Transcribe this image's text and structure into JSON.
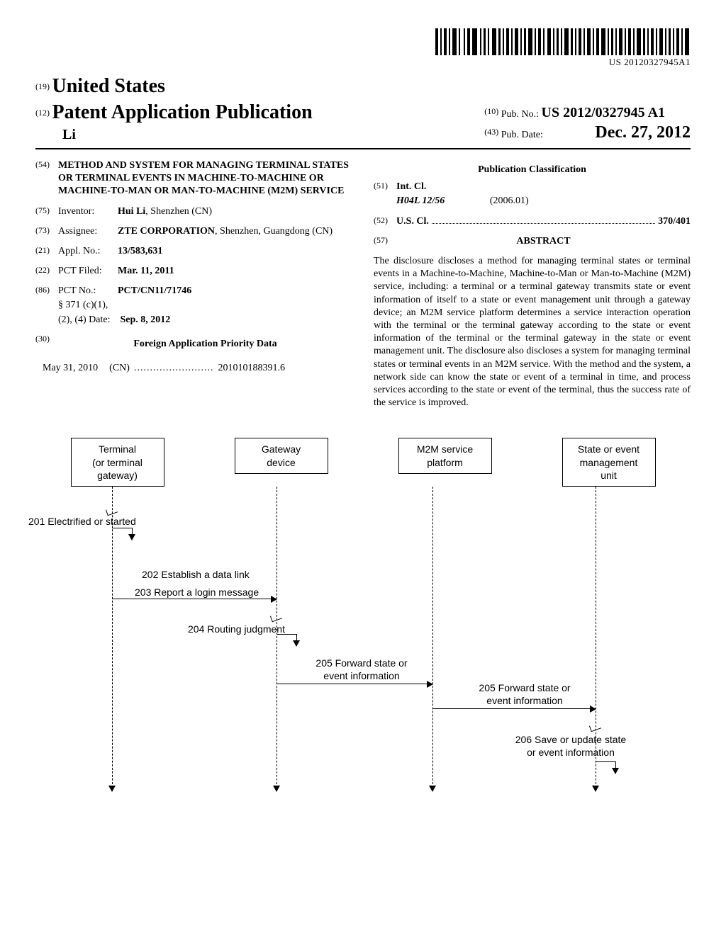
{
  "barcode_number": "US 20120327945A1",
  "header": {
    "code19": "(19)",
    "country": "United States",
    "code12": "(12)",
    "pap": "Patent Application Publication",
    "author": "Li",
    "code10": "(10)",
    "pubno_label": "Pub. No.:",
    "pubno_value": "US 2012/0327945 A1",
    "code43": "(43)",
    "pubdate_label": "Pub. Date:",
    "pubdate_value": "Dec. 27, 2012"
  },
  "left": {
    "c54": "(54)",
    "title": "METHOD AND SYSTEM FOR MANAGING TERMINAL STATES OR TERMINAL EVENTS IN MACHINE-TO-MACHINE OR MACHINE-TO-MAN OR MAN-TO-MACHINE (M2M) SERVICE",
    "c75": "(75)",
    "inventor_label": "Inventor:",
    "inventor": "Hui Li",
    "inventor_loc": ", Shenzhen (CN)",
    "c73": "(73)",
    "assignee_label": "Assignee:",
    "assignee": "ZTE CORPORATION",
    "assignee_loc": ", Shenzhen, Guangdong (CN)",
    "c21": "(21)",
    "appl_label": "Appl. No.:",
    "appl": "13/583,631",
    "c22": "(22)",
    "pct_filed_label": "PCT Filed:",
    "pct_filed": "Mar. 11, 2011",
    "c86": "(86)",
    "pct_no_label": "PCT No.:",
    "pct_no": "PCT/CN11/71746",
    "s371a": "§ 371 (c)(1),",
    "s371b": "(2), (4) Date:",
    "s371_date": "Sep. 8, 2012",
    "c30": "(30)",
    "foreign_header": "Foreign Application Priority Data",
    "foreign_date": "May 31, 2010",
    "foreign_cc": "(CN)",
    "foreign_dots": ".........................",
    "foreign_num": "201010188391.6"
  },
  "right": {
    "pubclass_header": "Publication Classification",
    "c51": "(51)",
    "intcl_label": "Int. Cl.",
    "intcl_code": "H04L 12/56",
    "intcl_year": "(2006.01)",
    "c52": "(52)",
    "uscl_label": "U.S. Cl.",
    "uscl_val": "370/401",
    "c57": "(57)",
    "abstract_label": "ABSTRACT",
    "abstract": "The disclosure discloses a method for managing terminal states or terminal events in a Machine-to-Machine, Machine-to-Man or Man-to-Machine (M2M) service, including: a terminal or a terminal gateway transmits state or event information of itself to a state or event management unit through a gateway device; an M2M service platform determines a service interaction operation with the terminal or the terminal gateway according to the state or event information of the terminal or the terminal gateway in the state or event management unit. The disclosure also discloses a system for managing terminal states or terminal events in an M2M service. With the method and the system, a network side can know the state or event of a terminal in time, and process services according to the state or event of the terminal, thus the success rate of the service is improved."
  },
  "diagram": {
    "boxes": {
      "b1a": "Terminal",
      "b1b": "(or terminal",
      "b1c": "gateway)",
      "b2a": "Gateway",
      "b2b": "device",
      "b3a": "M2M service",
      "b3b": "platform",
      "b4a": "State or event",
      "b4b": "management",
      "b4c": "unit"
    },
    "steps": {
      "s201": "201 Electrified or started",
      "s202": "202 Establish a data link",
      "s203": "203 Report a login message",
      "s204": "204 Routing judgment",
      "s205a": "205 Forward state or",
      "s205b": "event information",
      "s206a": "206 Save or update state",
      "s206b": "or event information"
    }
  }
}
